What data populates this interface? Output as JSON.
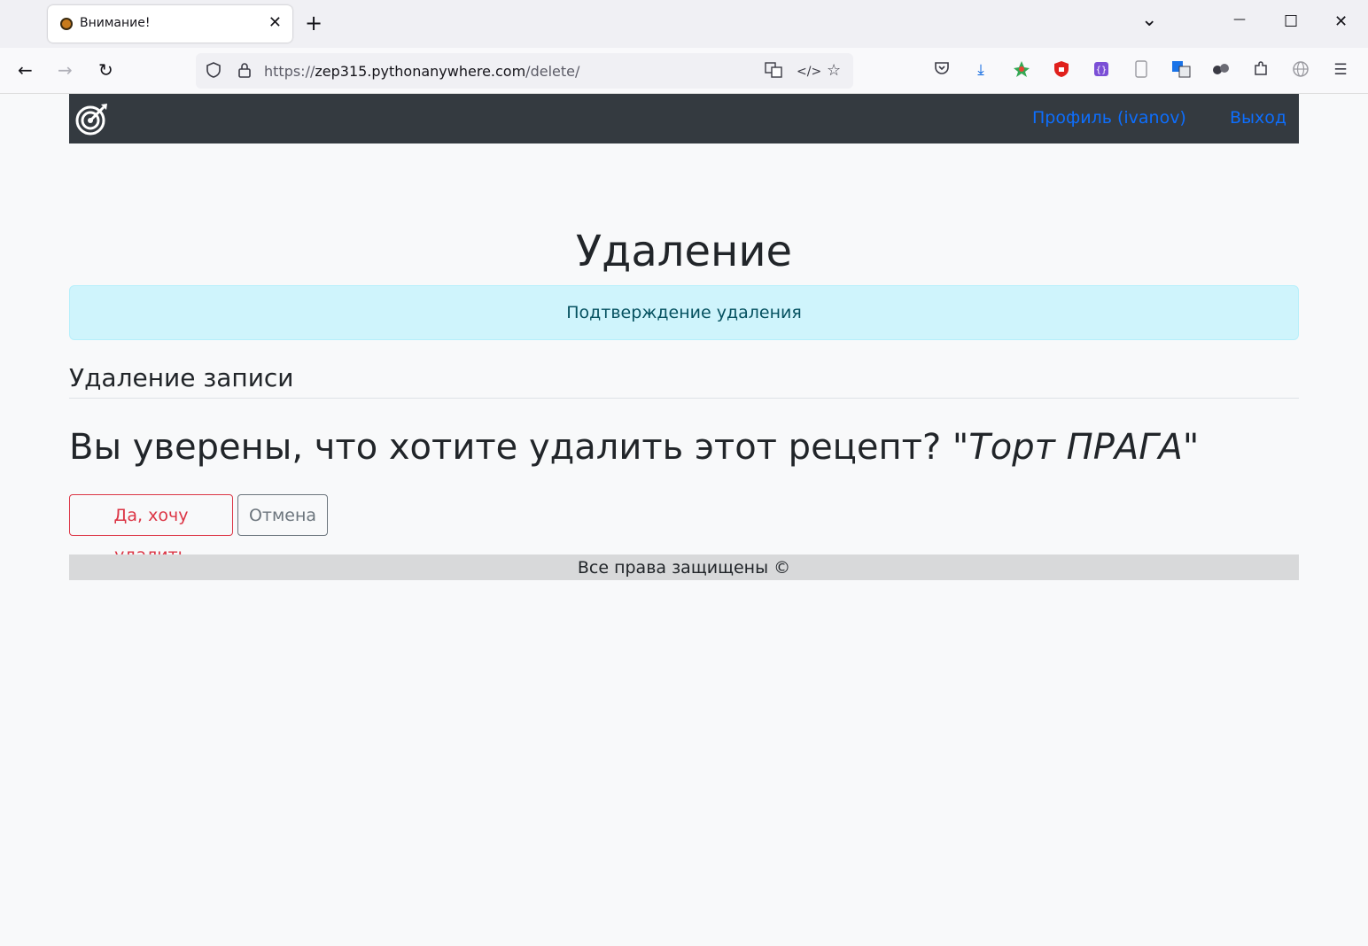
{
  "browser": {
    "tab_title": "Внимание!",
    "tab_close": "✕",
    "new_tab": "+",
    "tab_list": "⌄",
    "minimize": "—",
    "maximize": "☐",
    "close": "✕",
    "back": "←",
    "forward": "→",
    "reload": "↻",
    "url_prefix": "https://",
    "url_host": "zep315.pythonanywhere.com",
    "url_path": "/delete/",
    "toolbar_icons": [
      "pocket-icon",
      "download-icon",
      "extension-color-icon",
      "ublock-icon",
      "extension-icon",
      "phone-icon",
      "translate-icon",
      "extension-dots-icon",
      "extensions-icon",
      "globe-icon",
      "menu-icon"
    ]
  },
  "site_nav": {
    "profile_link": "Профиль (ivanov)",
    "logout_link": "Выход"
  },
  "main": {
    "title": "Удаление",
    "alert": "Подтверждение удаления",
    "subtitle": "Удаление записи",
    "question_prefix": "Вы уверены, что хотите удалить этот рецепт? \"",
    "recipe_name": "Торт ПРАГА",
    "question_suffix": "\"",
    "confirm_button": "Да, хочу удалить",
    "cancel_button": "Отмена"
  },
  "footer": {
    "text": "Все права защищены ©"
  },
  "colors": {
    "navbar_bg": "#343a40",
    "link": "#0d6efd",
    "danger": "#dc3545",
    "secondary": "#6c757d",
    "alert_bg": "#cff4fc",
    "alert_text": "#055160"
  }
}
